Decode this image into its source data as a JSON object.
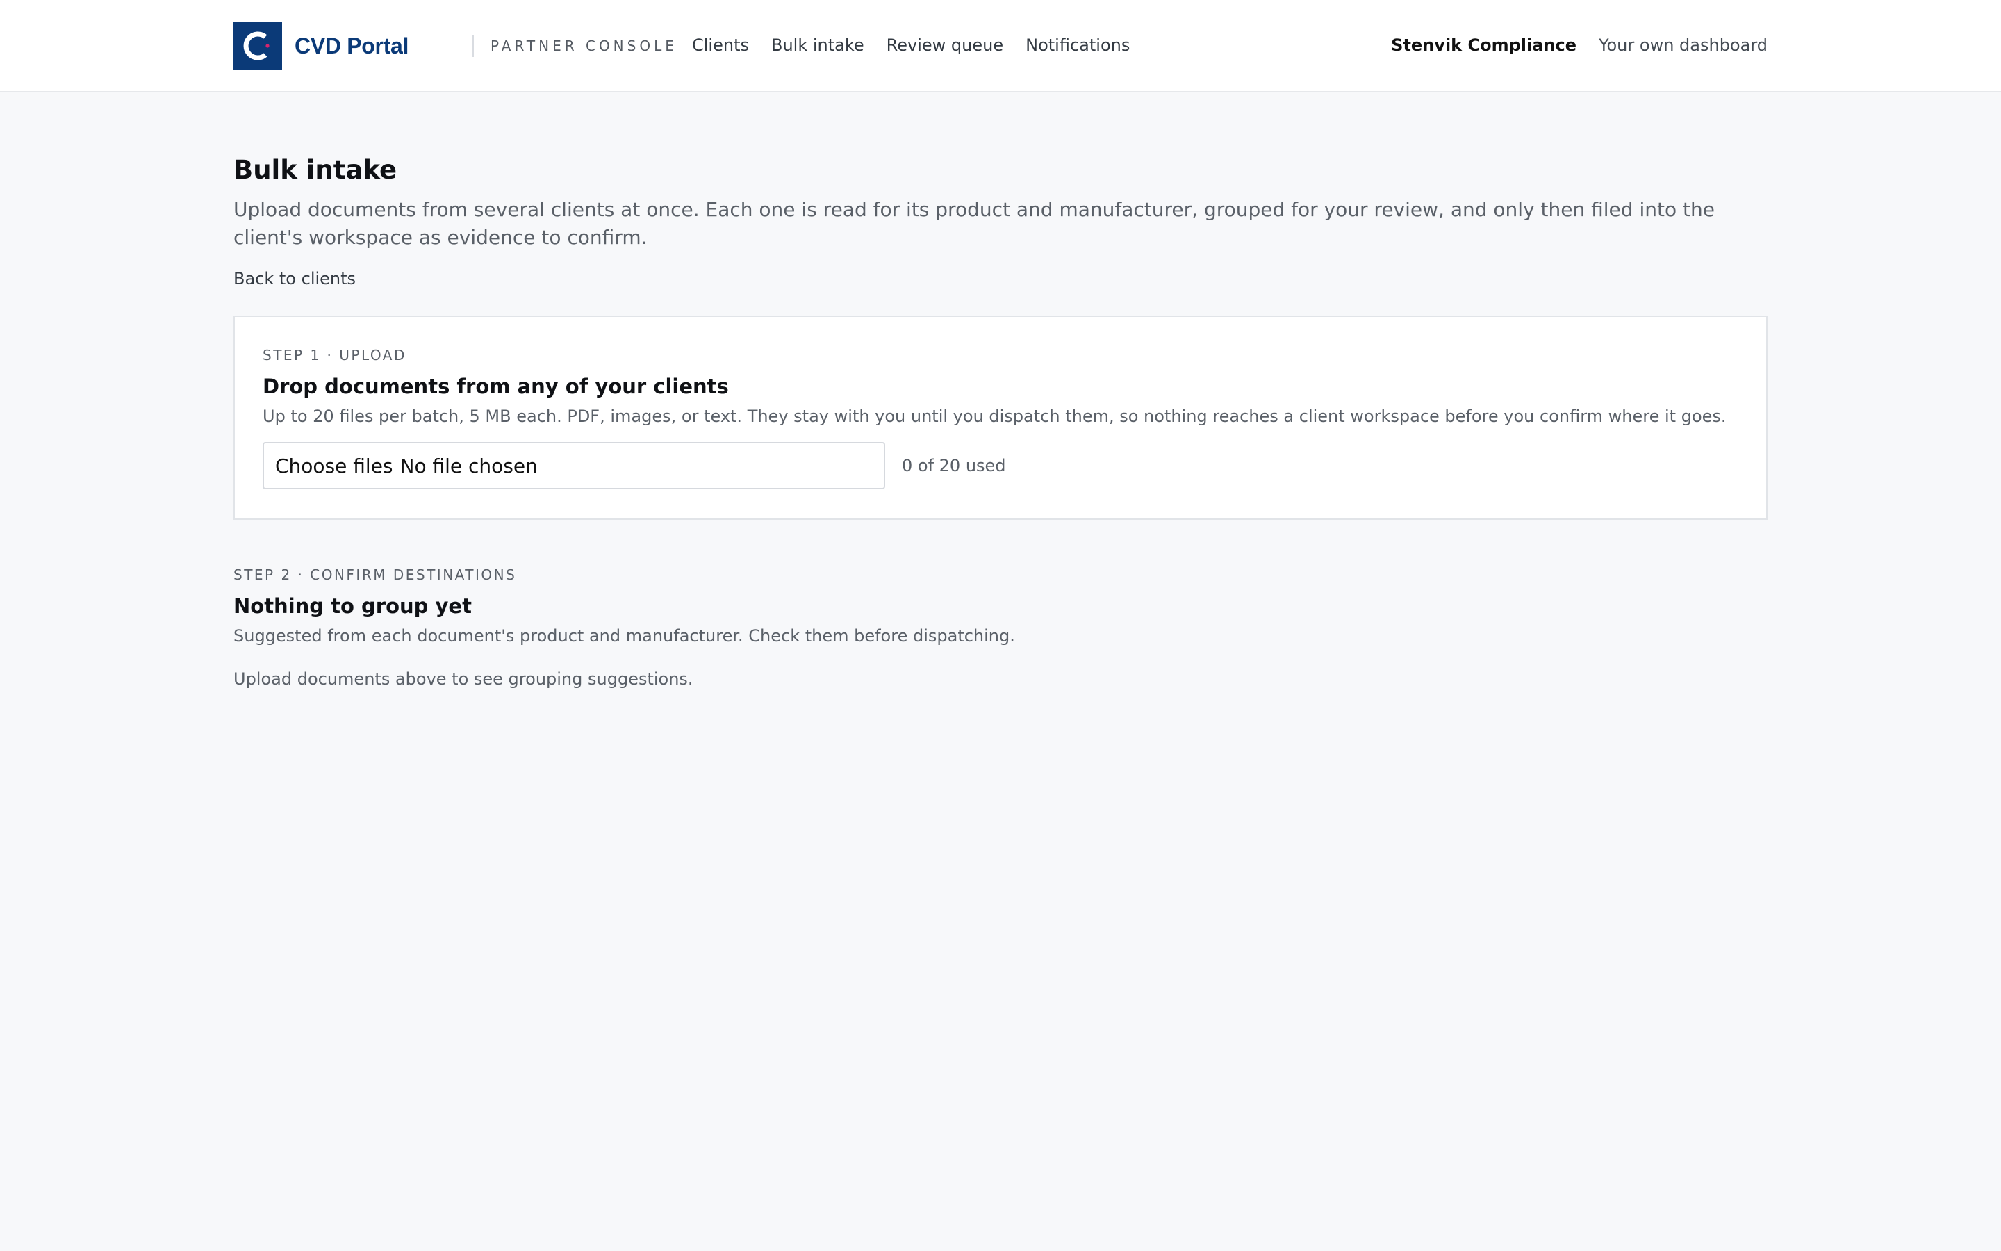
{
  "header": {
    "brand": "CVD Portal",
    "console_label": "PARTNER CONSOLE",
    "nav": [
      {
        "label": "Clients"
      },
      {
        "label": "Bulk intake"
      },
      {
        "label": "Review queue"
      },
      {
        "label": "Notifications"
      }
    ],
    "org_name": "Stenvik Compliance",
    "own_dashboard": "Your own dashboard"
  },
  "page": {
    "title": "Bulk intake",
    "description": "Upload documents from several clients at once. Each one is read for its product and manufacturer, grouped for your review, and only then filed into the client's workspace as evidence to confirm.",
    "back_link": "Back to clients"
  },
  "step1": {
    "label": "STEP 1 · UPLOAD",
    "title": "Drop documents from any of your clients",
    "description": "Up to 20 files per batch, 5 MB each. PDF, images, or text. They stay with you until you dispatch them, so nothing reaches a client workspace before you confirm where it goes.",
    "file_button": "Choose files",
    "file_status": "No file chosen",
    "used_text": "0 of 20 used",
    "used": 0,
    "limit": 20
  },
  "step2": {
    "label": "STEP 2 · CONFIRM DESTINATIONS",
    "title": "Nothing to group yet",
    "description": "Suggested from each document's product and manufacturer. Check them before dispatching.",
    "empty_message": "Upload documents above to see grouping suggestions."
  },
  "colors": {
    "brand": "#0b3a78",
    "brand_accent": "#d6246e",
    "background": "#f7f8fa",
    "card": "#ffffff"
  },
  "icons": {
    "logo": "cvd-logo-icon"
  }
}
